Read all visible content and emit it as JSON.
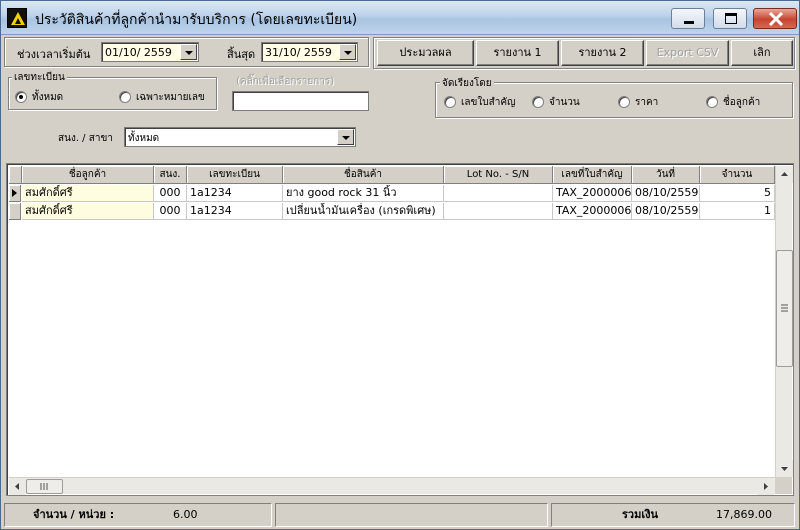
{
  "window": {
    "title": "ประวัติสินค้าที่ลูกค้านำมารับบริการ (โดยเลขทะเบียน)"
  },
  "filters": {
    "start_label": "ช่วงเวลาเริ่มต้น",
    "start_value": "01/10/ 2559",
    "end_label": "สิ้นสุด",
    "end_value": "31/10/ 2559",
    "plate_group_label": "เลขทะเบียน",
    "plate_all_label": "ทั้งหมด",
    "plate_specific_label": "เฉพาะหมายเลข",
    "plate_input_legend": "(คลิ๊กเพื่อเลือกรายการ)",
    "plate_input_value": "",
    "branch_label": "สนง. / สาขา",
    "branch_value": "ทั้งหมด",
    "sort_group_label": "จัดเรียงโดย",
    "sort_options": [
      "เลขใบสำคัญ",
      "จำนวน",
      "ราคา",
      "ชื่อลูกค้า"
    ]
  },
  "toolbar": {
    "process_label": "ประมวลผล",
    "report1_label": "รายงาน 1",
    "report2_label": "รายงาน 2",
    "export_label": "Export CSV",
    "quit_label": "เลิก"
  },
  "grid": {
    "columns": [
      "ชื่อลูกค้า",
      "สนง.",
      "เลขทะเบียน",
      "ชื่อสินค้า",
      "Lot No. - S/N",
      "เลขที่ใบสำคัญ",
      "วันที่",
      "จำนวน"
    ],
    "rows": [
      [
        "สมศักดิ์ศรี",
        "000",
        "1a1234",
        "ยาง good rock 31 นิ้ว",
        "",
        "TAX_2000006",
        "08/10/2559",
        "5"
      ],
      [
        "สมศักดิ์ศรี",
        "000",
        "1a1234",
        "เปลี่ยนน้ำมันเครื่อง (เกรดพิเศษ)",
        "",
        "TAX_2000006",
        "08/10/2559",
        "1"
      ]
    ]
  },
  "status": {
    "qty_label": "จำนวน / หน่วย :",
    "qty_value": "6.00",
    "total_label": "รวมเงิน",
    "total_value": "17,869.00"
  }
}
